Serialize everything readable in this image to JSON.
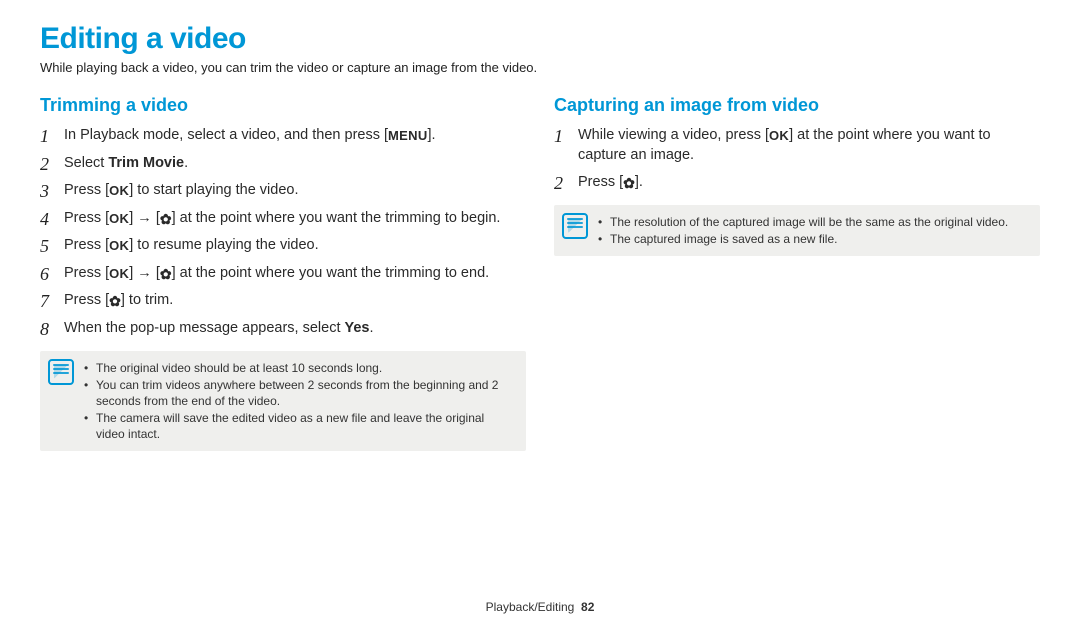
{
  "title": "Editing a video",
  "subtitle": "While playing back a video, you can trim the video or capture an image from the video.",
  "icons": {
    "menu": "MENU",
    "ok": "OK",
    "flower": "✿",
    "arrow": "→"
  },
  "left": {
    "heading": "Trimming a video",
    "steps": {
      "s1_a": "In Playback mode, select a video, and then press [",
      "s1_b": "].",
      "s2_a": "Select ",
      "s2_bold": "Trim Movie",
      "s2_b": ".",
      "s3_a": "Press [",
      "s3_b": "] to start playing the video.",
      "s4_a": "Press [",
      "s4_b": "] ",
      "s4_c": " [",
      "s4_d": "] at the point where you want the trimming to begin.",
      "s5_a": "Press [",
      "s5_b": "] to resume playing the video.",
      "s6_a": "Press [",
      "s6_b": "] ",
      "s6_c": " [",
      "s6_d": "] at the point where you want the trimming to end.",
      "s7_a": "Press [",
      "s7_b": "] to trim.",
      "s8_a": "When the pop-up message appears, select ",
      "s8_bold": "Yes",
      "s8_b": "."
    },
    "notes": [
      "The original video should be at least 10 seconds long.",
      "You can trim videos anywhere between 2 seconds from the beginning and 2 seconds from the end of the video.",
      "The camera will save the edited video as a new file and leave the original video intact."
    ]
  },
  "right": {
    "heading": "Capturing an image from video",
    "steps": {
      "s1_a": "While viewing a video, press [",
      "s1_b": "] at the point where you want to capture an image.",
      "s2_a": "Press [",
      "s2_b": "]."
    },
    "notes": [
      "The resolution of the captured image will be the same as the original video.",
      "The captured image is saved as a new file."
    ]
  },
  "footer": {
    "section": "Playback/Editing",
    "page": "82"
  }
}
